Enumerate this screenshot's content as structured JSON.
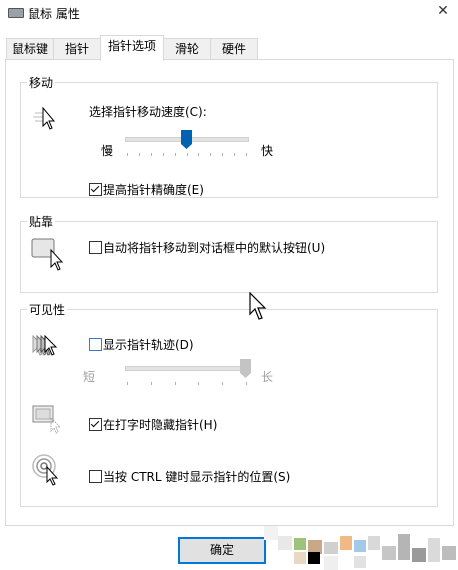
{
  "window": {
    "title": "鼠标 属性",
    "close_label": "✕"
  },
  "tabs": [
    "鼠标键",
    "指针",
    "指针选项",
    "滑轮",
    "硬件"
  ],
  "active_tab": "指针选项",
  "motion": {
    "legend": "移动",
    "speed_label": "选择指针移动速度(C):",
    "slow": "慢",
    "fast": "快",
    "speed_level": 0.5,
    "precision_label": "提高指针精确度(E)",
    "precision_checked": true
  },
  "snap": {
    "legend": "贴靠",
    "label": "自动将指针移动到对话框中的默认按钮(U)",
    "checked": false
  },
  "visibility": {
    "legend": "可见性",
    "trails_label": "显示指针轨迹(D)",
    "trails_checked": false,
    "short": "短",
    "long": "长",
    "trail_level": 1.0,
    "hide_typing_label": "在打字时隐藏指针(H)",
    "hide_typing_checked": true,
    "ctrl_label": "当按 CTRL 键时显示指针的位置(S)",
    "ctrl_checked": false
  },
  "buttons": {
    "ok": "确定"
  },
  "colors": {
    "accent": "#0078d7",
    "thumb": "#0063b1",
    "disabled": "#a0a0a0"
  }
}
